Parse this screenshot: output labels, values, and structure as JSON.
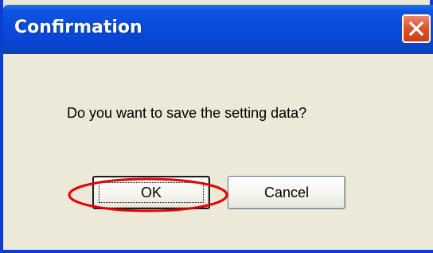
{
  "window": {
    "title": "Confirmation",
    "close_icon": "close-icon"
  },
  "dialog": {
    "message": "Do you want to save the setting data?",
    "ok_label": "OK",
    "cancel_label": "Cancel"
  },
  "annotation": {
    "highlight_target": "ok-button",
    "highlight_color": "#e60000"
  },
  "colors": {
    "titlebar": "#0a4ddc",
    "client_bg": "#ece9d8",
    "close_button": "#d9562f"
  }
}
